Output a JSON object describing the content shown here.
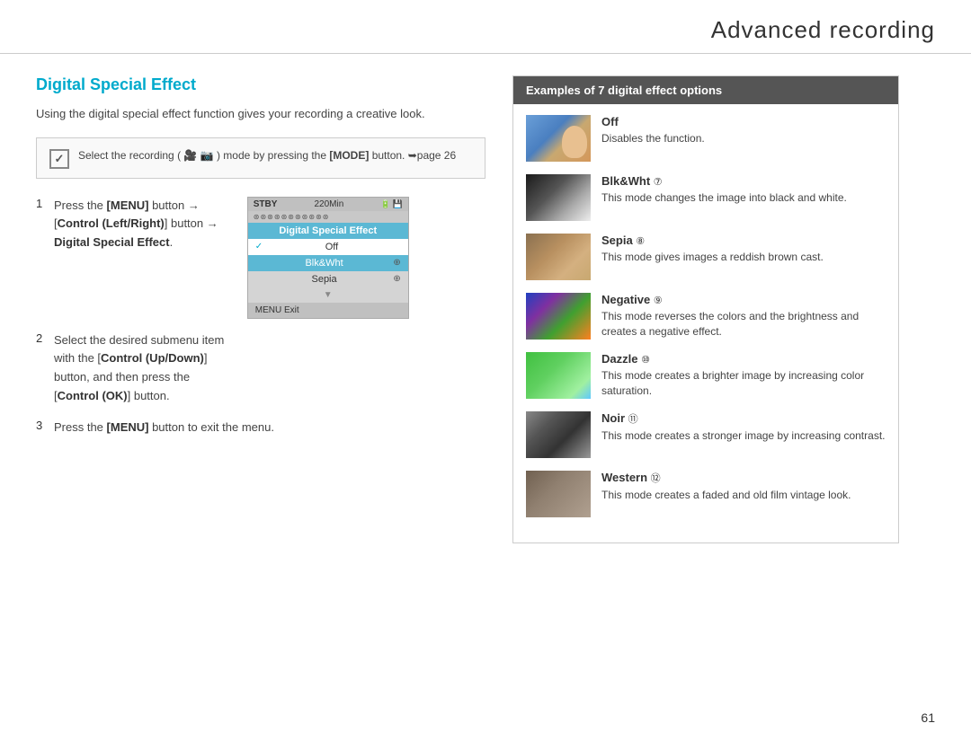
{
  "page": {
    "title": "Advanced recording",
    "number": "61"
  },
  "section": {
    "title": "Digital Special Effect",
    "intro": "Using the digital special effect function gives your recording a creative look."
  },
  "note": {
    "text": "Select the recording (",
    "text2": ") mode by pressing the ",
    "bold_mode": "MODE",
    "text3": " button. ",
    "page_ref": "➥page 26"
  },
  "steps": [
    {
      "num": "1",
      "parts": [
        {
          "text": "Press the ",
          "bold": "MENU",
          "text2": " button → [",
          "bold2": "Control (Left/Right)",
          "text3": "] button → ",
          "bold3": "Digital Special Effect",
          "text4": "."
        }
      ]
    },
    {
      "num": "2",
      "parts": [
        {
          "text": "Select the desired submenu item with the [",
          "bold": "Control (Up/Down)",
          "text2": "] button, and then press the [",
          "bold2": "Control (OK)",
          "text3": "] button."
        }
      ]
    },
    {
      "num": "3",
      "parts": [
        {
          "text": "Press the ",
          "bold": "MENU",
          "text2": " button to exit the menu."
        }
      ]
    }
  ],
  "camera_menu": {
    "stby": "STBY",
    "time": "220Min",
    "title": "Digital Special Effect",
    "items": [
      {
        "label": "Off",
        "state": "selected",
        "icon": "✓"
      },
      {
        "label": "Blk&Wht",
        "state": "normal",
        "icon": "⊕"
      },
      {
        "label": "Sepia",
        "state": "normal",
        "icon": "⊕"
      }
    ],
    "footer": "MENU Exit"
  },
  "examples_box": {
    "header": "Examples of 7 digital effect options",
    "effects": [
      {
        "name": "Off",
        "icon": "",
        "desc": "Disables the function.",
        "thumb_class": "thumb-off"
      },
      {
        "name": "Blk&Wht",
        "icon": "㊙",
        "desc": "This mode changes the image into black and white.",
        "thumb_class": "thumb-blkwht"
      },
      {
        "name": "Sepia",
        "icon": "㊙",
        "desc": "This mode gives images a reddish brown cast.",
        "thumb_class": "thumb-sepia"
      },
      {
        "name": "Negative",
        "icon": "㊙",
        "desc": "This mode reverses the colors and the brightness and creates a negative effect.",
        "thumb_class": "thumb-negative"
      },
      {
        "name": "Dazzle",
        "icon": "㊙",
        "desc": "This mode creates a brighter image by increasing color saturation.",
        "thumb_class": "thumb-dazzle"
      },
      {
        "name": "Noir",
        "icon": "㊙",
        "desc": "This mode creates a stronger image by increasing contrast.",
        "thumb_class": "thumb-noir"
      },
      {
        "name": "Western",
        "icon": "㊙",
        "desc": "This mode creates a faded and old film vintage look.",
        "thumb_class": "thumb-western"
      }
    ]
  },
  "icons": {
    "note_icon": "✓",
    "blkwht_sym": "⑦",
    "sepia_sym": "⑧",
    "negative_sym": "⑨",
    "dazzle_sym": "⑩",
    "noir_sym": "⑪",
    "western_sym": "⑫"
  }
}
